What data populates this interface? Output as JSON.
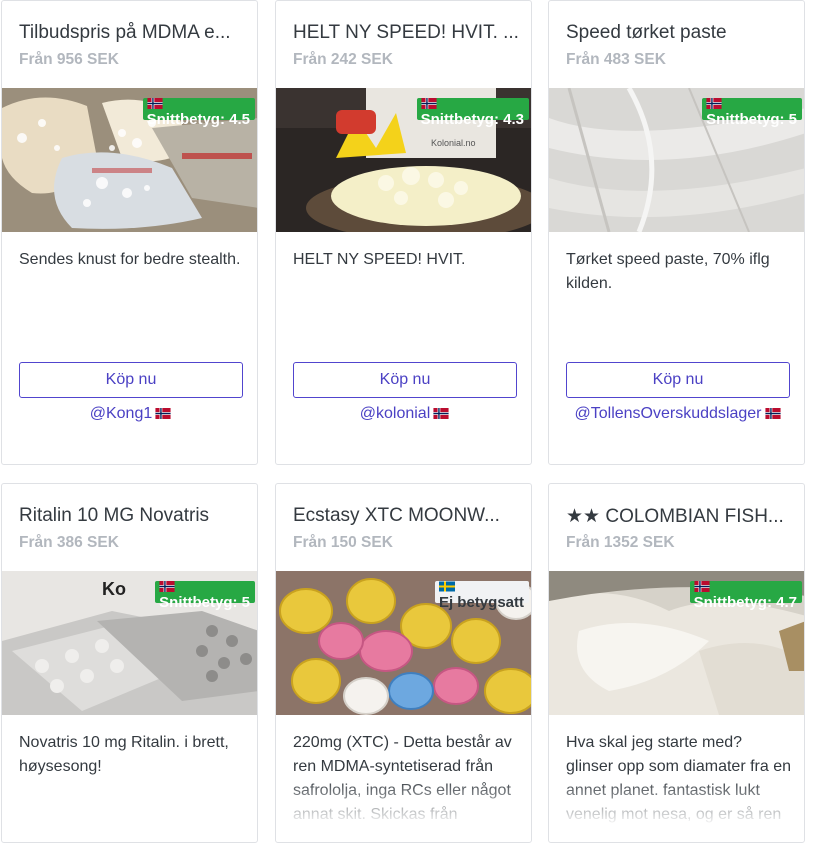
{
  "listings": [
    {
      "title": "Tilbudspris på MDMA e...",
      "price": "Från 956 SEK",
      "badge": "Snittbetyg: 4.5",
      "badge_flag": "norway-flag",
      "description": "Sendes knust for bedre stealth.",
      "buy_label": "Köp nu",
      "seller": "@Kong1",
      "seller_flag": "norway-flag",
      "image": "crushed-crystal-bags-photo"
    },
    {
      "title": "HELT NY SPEED! HVIT. ...",
      "price": "Från 242 SEK",
      "badge": "Snittbetyg: 4.3",
      "badge_flag": "norway-flag",
      "description": "HELT NY SPEED! HVIT.",
      "buy_label": "Köp nu",
      "seller": "@kolonial",
      "seller_flag": "norway-flag",
      "image": "white-powder-bowl-photo",
      "image_text": "Kolonial.no"
    },
    {
      "title": "Speed tørket paste",
      "price": "Från 483 SEK",
      "badge": "Snittbetyg: 5",
      "badge_flag": "norway-flag",
      "description": "Tørket speed paste, 70% iflg kilden.",
      "buy_label": "Köp nu",
      "seller": "@TollensOverskuddslager",
      "seller_flag": "norway-flag",
      "image": "plastic-wrap-photo"
    },
    {
      "title": "Ritalin 10 MG Novatris",
      "price": "Från 386 SEK",
      "badge": "Snittbetyg: 5",
      "badge_flag": "norway-flag",
      "description": "Novatris 10 mg Ritalin. i brett, høysesong!",
      "image": "pill-blister-photo",
      "image_text": "Ko"
    },
    {
      "title": "Ecstasy XTC MOONW...",
      "price": "Från 150 SEK",
      "badge": "Ej betygsatt",
      "badge_flag": "sweden-flag",
      "badge_style": "unrated",
      "description": "220mg (XTC) - Detta består av ren MDMA-syntetiserad från safrololja, inga RCs eller något annat skit. Skickas från",
      "image": "colored-pills-photo"
    },
    {
      "title": "★★ COLOMBIAN FISH...",
      "price": "Från 1352 SEK",
      "badge": "Snittbetyg: 4.7",
      "badge_flag": "norway-flag",
      "description": "Hva skal jeg starte med? glinser opp som diamater fra en annet planet. fantastisk lukt venelig mot nesa, og er så ren",
      "image": "white-rock-photo"
    }
  ],
  "colors": {
    "badge_green": "#27a844",
    "button_purple": "#5145ce",
    "muted_price": "#b2b7be"
  }
}
